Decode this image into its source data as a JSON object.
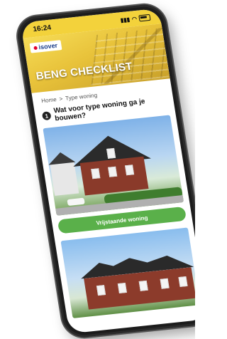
{
  "status": {
    "time": "16:24"
  },
  "brand": {
    "logo_text": "isover"
  },
  "hero": {
    "title": "BENG CHECKLIST"
  },
  "breadcrumb": {
    "home": "Home",
    "separator": ">",
    "current": "Type woning"
  },
  "question": {
    "number": "1",
    "text": "Wat voor type woning ga je bouwen?"
  },
  "options": [
    {
      "button_label": "Vrijstaande woning"
    }
  ],
  "colors": {
    "header_yellow": "#f3d23b",
    "button_green": "#5ab04a"
  },
  "icons": {
    "signal": "signal-icon",
    "wifi": "wifi-icon",
    "battery": "battery-icon"
  }
}
